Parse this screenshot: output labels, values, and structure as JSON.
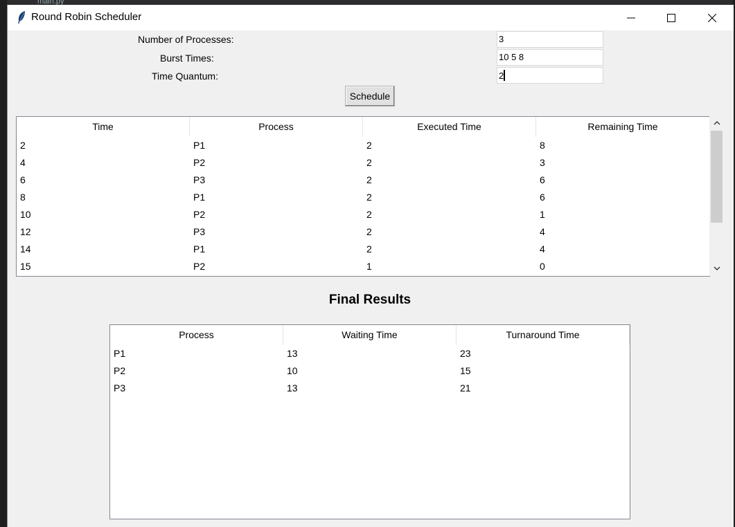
{
  "window": {
    "title": "Round Robin Scheduler",
    "background_tab": "main.py"
  },
  "form": {
    "num_processes_label": "Number of Processes:",
    "num_processes_value": "3",
    "burst_times_label": "Burst Times:",
    "burst_times_value": "10 5 8",
    "time_quantum_label": "Time Quantum:",
    "time_quantum_value": "2",
    "schedule_button": "Schedule"
  },
  "timeline": {
    "columns": [
      "Time",
      "Process",
      "Executed Time",
      "Remaining Time"
    ],
    "rows": [
      [
        "2",
        "P1",
        "2",
        "8"
      ],
      [
        "4",
        "P2",
        "2",
        "3"
      ],
      [
        "6",
        "P3",
        "2",
        "6"
      ],
      [
        "8",
        "P1",
        "2",
        "6"
      ],
      [
        "10",
        "P2",
        "2",
        "1"
      ],
      [
        "12",
        "P3",
        "2",
        "4"
      ],
      [
        "14",
        "P1",
        "2",
        "4"
      ],
      [
        "15",
        "P2",
        "1",
        "0"
      ]
    ]
  },
  "results": {
    "title": "Final Results",
    "columns": [
      "Process",
      "Waiting Time",
      "Turnaround Time"
    ],
    "rows": [
      [
        "P1",
        "13",
        "23"
      ],
      [
        "P2",
        "10",
        "15"
      ],
      [
        "P3",
        "13",
        "21"
      ]
    ]
  },
  "icons": {
    "app": "feather-icon",
    "minimize": "minimize-icon",
    "maximize": "maximize-icon",
    "close": "close-icon",
    "scroll_up": "chevron-up-icon",
    "scroll_down": "chevron-down-icon"
  }
}
